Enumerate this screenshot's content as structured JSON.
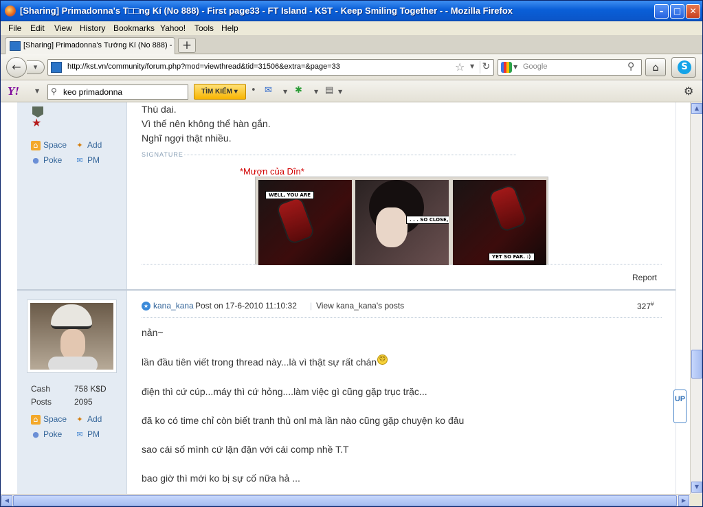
{
  "window": {
    "title": "[Sharing] Primadonna's T□□ng Kí (No 888) - First page33 - FT Island - KST - Keep Smiling Together - - Mozilla Firefox",
    "minimize_glyph": "–",
    "maximize_glyph": "□",
    "close_glyph": "✕"
  },
  "menu": [
    "File",
    "Edit",
    "View",
    "History",
    "Bookmarks",
    "Yahoo!",
    "Tools",
    "Help"
  ],
  "tab": {
    "label": "[Sharing] Primadonna's Tướng Kí (No 888) - ...",
    "new_tab_glyph": "+"
  },
  "nav": {
    "url": "http://kst.vn/community/forum.php?mod=viewthread&tid=31506&extra=&page=33",
    "search_placeholder": "Google"
  },
  "yahoo": {
    "logo": "Y!",
    "search_value": "keo primadonna",
    "search_button": "TÌM KIẾM ▾"
  },
  "post1": {
    "lines": [
      "Thù dai.",
      "Vì thế nên không thể hàn gắn.",
      "Nghĩ ngợi thật nhiều."
    ],
    "signature_label": "SIGNATURE",
    "signature_caption": "*Mượn của Dîn*",
    "comic_bubbles": [
      "WELL, YOU ARE",
      ". . . SO CLOSE,",
      "YET SO FAR. :)"
    ],
    "report_label": "Report",
    "links": {
      "space": "Space",
      "add": "Add",
      "poke": "Poke",
      "pm": "PM"
    }
  },
  "post2": {
    "author": "kana_kana",
    "post_meta": "Post on 17-6-2010 11:10:32",
    "view_posts": "View kana_kana's posts",
    "floor": "327",
    "floor_mark": "#",
    "stats": [
      {
        "label": "Cash",
        "value": "758 K$D"
      },
      {
        "label": "Posts",
        "value": "2095"
      }
    ],
    "links": {
      "space": "Space",
      "add": "Add",
      "poke": "Poke",
      "pm": "PM"
    },
    "lines": [
      "nản~",
      "lần đầu tiên viết trong thread này...là vì thật sự rất chán",
      "điện thì cứ cúp...máy thì cứ hỏng....làm việc gì cũng gặp trục trặc...",
      "đã ko có time chỉ còn biết tranh thủ onl mà lần nào cũng gặp chuyện ko đâu",
      "sao cái số mình cứ lận đận với cái comp nhề T.T",
      "bao giờ thì mới ko bị sự cố nữa hả ..."
    ]
  },
  "up_widget": "UP",
  "icons": {
    "space": "home-icon",
    "add": "handshake-icon",
    "poke": "poke-icon",
    "pm": "mail-icon"
  }
}
